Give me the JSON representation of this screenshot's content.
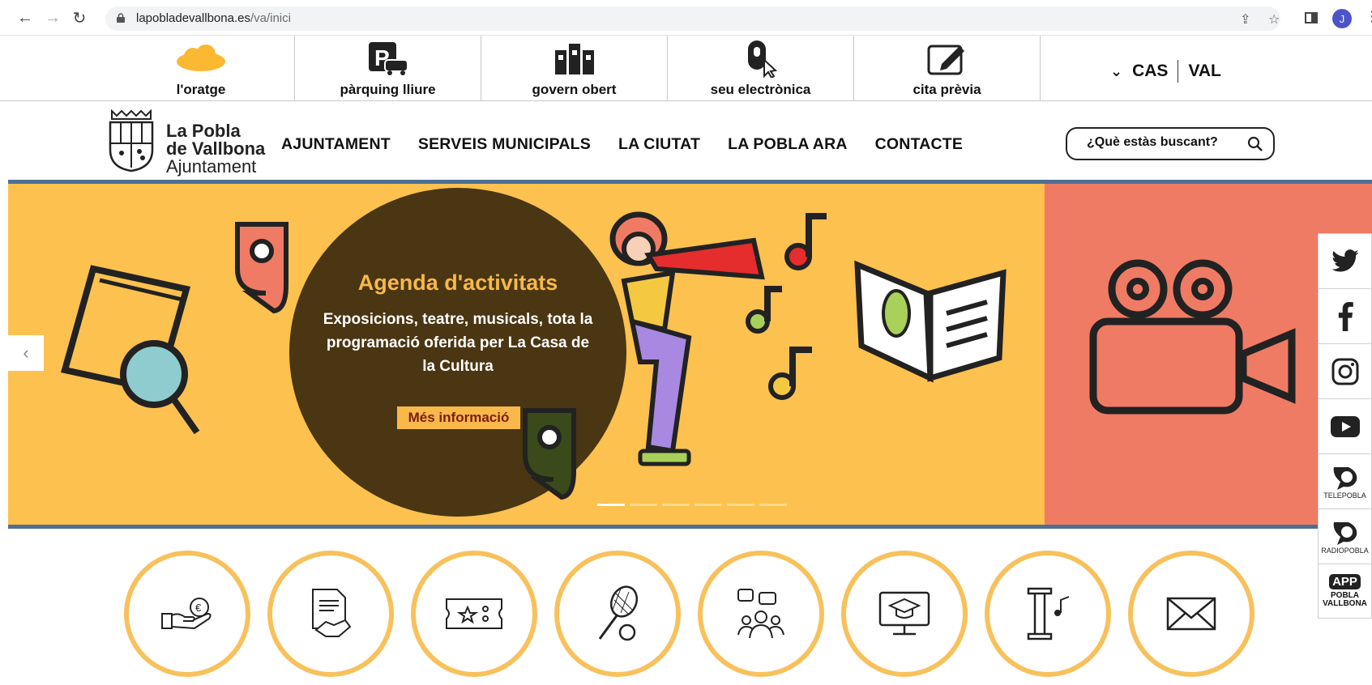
{
  "browser": {
    "url_domain": "lapobladevallbona.es",
    "url_path": "/va/inici",
    "profile_initial": "J"
  },
  "quicklinks": [
    {
      "label": "l'oratge",
      "icon": "cloud-icon"
    },
    {
      "label": "pàrquing lliure",
      "icon": "parking-icon"
    },
    {
      "label": "govern obert",
      "icon": "buildings-icon"
    },
    {
      "label": "seu electrònica",
      "icon": "mouse-icon"
    },
    {
      "label": "cita prèvia",
      "icon": "edit-icon"
    }
  ],
  "language": {
    "cas": "CAS",
    "val": "VAL"
  },
  "logo": {
    "line1": "La Pobla",
    "line2": "de Vallbona",
    "line3": "Ajuntament"
  },
  "menu": [
    "AJUNTAMENT",
    "SERVEIS MUNICIPALS",
    "LA CIUTAT",
    "LA POBLA ARA",
    "CONTACTE"
  ],
  "search": {
    "placeholder": "¿Què estàs buscant?"
  },
  "hero": {
    "title": "Agenda d'activitats",
    "text": "Exposicions, teatre, musicals, tota la programació oferida per La Casa de la Cultura",
    "button": "Més informació",
    "slides": 6,
    "active_slide": 1
  },
  "social": [
    {
      "name": "twitter",
      "caption": ""
    },
    {
      "name": "facebook",
      "caption": ""
    },
    {
      "name": "instagram",
      "caption": ""
    },
    {
      "name": "youtube",
      "caption": ""
    },
    {
      "name": "telepobla",
      "caption": "TELEPOBLA"
    },
    {
      "name": "radiopobla",
      "caption": "RADIOPOBLA"
    },
    {
      "name": "app",
      "caption": "POBLA VALLBONA"
    }
  ],
  "app_badge": "APP",
  "services": [
    "tax-icon",
    "agreement-icon",
    "ticket-icon",
    "tennis-icon",
    "participation-icon",
    "online-training-icon",
    "culture-icon",
    "mail-icon"
  ],
  "colors": {
    "accent": "#fcc14f",
    "hero_red": "#f07b64",
    "bubble": "#4a3612",
    "bar": "#4e6f93"
  }
}
